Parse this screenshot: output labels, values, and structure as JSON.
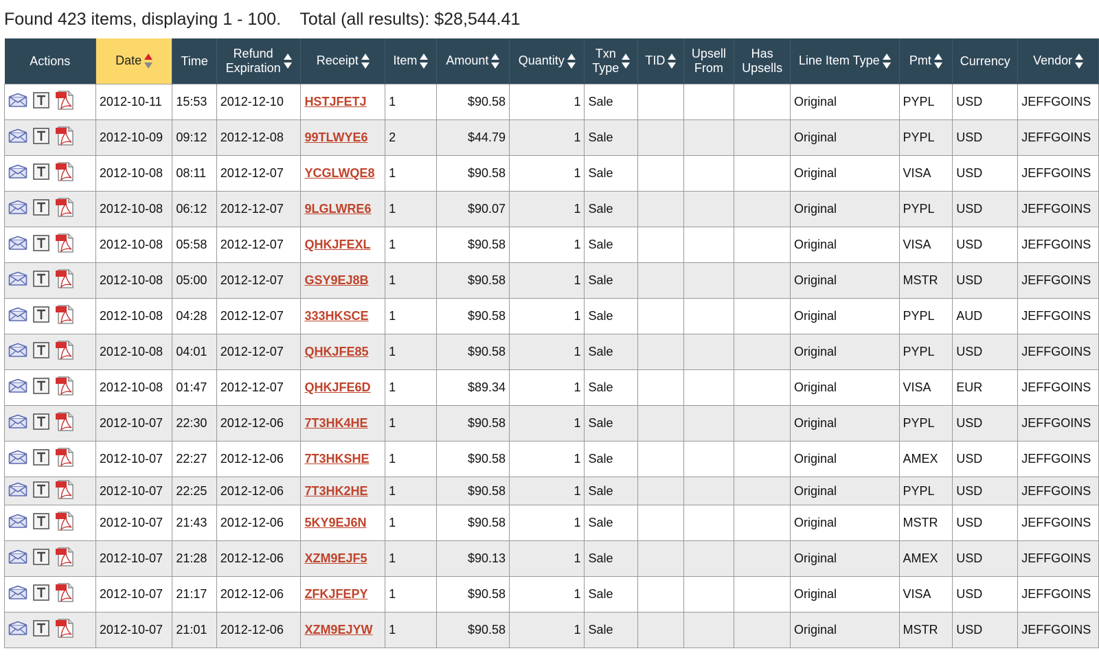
{
  "summary": "Found 423 items, displaying 1 - 100.    Total (all results): $28,544.41",
  "colors": {
    "header_bg": "#2f4858",
    "sorted_header_bg": "#fcd86a",
    "receipt_link": "#c0432b",
    "alt_row": "#ebebeb"
  },
  "columns": {
    "actions": "Actions",
    "date": "Date",
    "time": "Time",
    "refund_l1": "Refund",
    "refund_l2": "Expiration",
    "receipt": "Receipt",
    "item": "Item",
    "amount": "Amount",
    "quantity": "Quantity",
    "txn_l1": "Txn",
    "txn_l2": "Type",
    "tid": "TID",
    "upsell_l1": "Upsell",
    "upsell_l2": "From",
    "has_l1": "Has",
    "has_l2": "Upsells",
    "line_item_type": "Line Item Type",
    "pmt": "Pmt",
    "currency": "Currency",
    "vendor": "Vendor"
  },
  "action_icons": [
    "envelope-icon",
    "text-t-icon",
    "pdf-icon"
  ],
  "rows": [
    {
      "date": "2012-10-11",
      "time": "15:53",
      "refund": "2012-12-10",
      "receipt": "HSTJFETJ",
      "item": "1",
      "amount": "$90.58",
      "quantity": "1",
      "txn_type": "Sale",
      "tid": "",
      "upsell_from": "",
      "has_upsells": "",
      "line_item_type": "Original",
      "pmt": "PYPL",
      "currency": "USD",
      "vendor": "JEFFGOINS"
    },
    {
      "date": "2012-10-09",
      "time": "09:12",
      "refund": "2012-12-08",
      "receipt": "99TLWYE6",
      "item": "2",
      "amount": "$44.79",
      "quantity": "1",
      "txn_type": "Sale",
      "tid": "",
      "upsell_from": "",
      "has_upsells": "",
      "line_item_type": "Original",
      "pmt": "PYPL",
      "currency": "USD",
      "vendor": "JEFFGOINS"
    },
    {
      "date": "2012-10-08",
      "time": "08:11",
      "refund": "2012-12-07",
      "receipt": "YCGLWQE8",
      "item": "1",
      "amount": "$90.58",
      "quantity": "1",
      "txn_type": "Sale",
      "tid": "",
      "upsell_from": "",
      "has_upsells": "",
      "line_item_type": "Original",
      "pmt": "VISA",
      "currency": "USD",
      "vendor": "JEFFGOINS"
    },
    {
      "date": "2012-10-08",
      "time": "06:12",
      "refund": "2012-12-07",
      "receipt": "9LGLWRE6",
      "item": "1",
      "amount": "$90.07",
      "quantity": "1",
      "txn_type": "Sale",
      "tid": "",
      "upsell_from": "",
      "has_upsells": "",
      "line_item_type": "Original",
      "pmt": "PYPL",
      "currency": "USD",
      "vendor": "JEFFGOINS"
    },
    {
      "date": "2012-10-08",
      "time": "05:58",
      "refund": "2012-12-07",
      "receipt": "QHKJFEXL",
      "item": "1",
      "amount": "$90.58",
      "quantity": "1",
      "txn_type": "Sale",
      "tid": "",
      "upsell_from": "",
      "has_upsells": "",
      "line_item_type": "Original",
      "pmt": "VISA",
      "currency": "USD",
      "vendor": "JEFFGOINS"
    },
    {
      "date": "2012-10-08",
      "time": "05:00",
      "refund": "2012-12-07",
      "receipt": "GSY9EJ8B",
      "item": "1",
      "amount": "$90.58",
      "quantity": "1",
      "txn_type": "Sale",
      "tid": "",
      "upsell_from": "",
      "has_upsells": "",
      "line_item_type": "Original",
      "pmt": "MSTR",
      "currency": "USD",
      "vendor": "JEFFGOINS"
    },
    {
      "date": "2012-10-08",
      "time": "04:28",
      "refund": "2012-12-07",
      "receipt": "333HKSCE",
      "item": "1",
      "amount": "$90.58",
      "quantity": "1",
      "txn_type": "Sale",
      "tid": "",
      "upsell_from": "",
      "has_upsells": "",
      "line_item_type": "Original",
      "pmt": "PYPL",
      "currency": "AUD",
      "vendor": "JEFFGOINS"
    },
    {
      "date": "2012-10-08",
      "time": "04:01",
      "refund": "2012-12-07",
      "receipt": "QHKJFE85",
      "item": "1",
      "amount": "$90.58",
      "quantity": "1",
      "txn_type": "Sale",
      "tid": "",
      "upsell_from": "",
      "has_upsells": "",
      "line_item_type": "Original",
      "pmt": "PYPL",
      "currency": "USD",
      "vendor": "JEFFGOINS"
    },
    {
      "date": "2012-10-08",
      "time": "01:47",
      "refund": "2012-12-07",
      "receipt": "QHKJFE6D",
      "item": "1",
      "amount": "$89.34",
      "quantity": "1",
      "txn_type": "Sale",
      "tid": "",
      "upsell_from": "",
      "has_upsells": "",
      "line_item_type": "Original",
      "pmt": "VISA",
      "currency": "EUR",
      "vendor": "JEFFGOINS"
    },
    {
      "date": "2012-10-07",
      "time": "22:30",
      "refund": "2012-12-06",
      "receipt": "7T3HK4HE",
      "item": "1",
      "amount": "$90.58",
      "quantity": "1",
      "txn_type": "Sale",
      "tid": "",
      "upsell_from": "",
      "has_upsells": "",
      "line_item_type": "Original",
      "pmt": "PYPL",
      "currency": "USD",
      "vendor": "JEFFGOINS"
    },
    {
      "date": "2012-10-07",
      "time": "22:27",
      "refund": "2012-12-06",
      "receipt": "7T3HKSHE",
      "item": "1",
      "amount": "$90.58",
      "quantity": "1",
      "txn_type": "Sale",
      "tid": "",
      "upsell_from": "",
      "has_upsells": "",
      "line_item_type": "Original",
      "pmt": "AMEX",
      "currency": "USD",
      "vendor": "JEFFGOINS"
    },
    {
      "date": "2012-10-07",
      "time": "22:25",
      "refund": "2012-12-06",
      "receipt": "7T3HK2HE",
      "item": "1",
      "amount": "$90.58",
      "quantity": "1",
      "txn_type": "Sale",
      "tid": "",
      "upsell_from": "",
      "has_upsells": "",
      "line_item_type": "Original",
      "pmt": "PYPL",
      "currency": "USD",
      "vendor": "JEFFGOINS"
    },
    {
      "date": "2012-10-07",
      "time": "21:43",
      "refund": "2012-12-06",
      "receipt": "5KY9EJ6N",
      "item": "1",
      "amount": "$90.58",
      "quantity": "1",
      "txn_type": "Sale",
      "tid": "",
      "upsell_from": "",
      "has_upsells": "",
      "line_item_type": "Original",
      "pmt": "MSTR",
      "currency": "USD",
      "vendor": "JEFFGOINS"
    },
    {
      "date": "2012-10-07",
      "time": "21:28",
      "refund": "2012-12-06",
      "receipt": "XZM9EJF5",
      "item": "1",
      "amount": "$90.13",
      "quantity": "1",
      "txn_type": "Sale",
      "tid": "",
      "upsell_from": "",
      "has_upsells": "",
      "line_item_type": "Original",
      "pmt": "AMEX",
      "currency": "USD",
      "vendor": "JEFFGOINS"
    },
    {
      "date": "2012-10-07",
      "time": "21:17",
      "refund": "2012-12-06",
      "receipt": "ZFKJFEPY",
      "item": "1",
      "amount": "$90.58",
      "quantity": "1",
      "txn_type": "Sale",
      "tid": "",
      "upsell_from": "",
      "has_upsells": "",
      "line_item_type": "Original",
      "pmt": "VISA",
      "currency": "USD",
      "vendor": "JEFFGOINS"
    },
    {
      "date": "2012-10-07",
      "time": "21:01",
      "refund": "2012-12-06",
      "receipt": "XZM9EJYW",
      "item": "1",
      "amount": "$90.58",
      "quantity": "1",
      "txn_type": "Sale",
      "tid": "",
      "upsell_from": "",
      "has_upsells": "",
      "line_item_type": "Original",
      "pmt": "MSTR",
      "currency": "USD",
      "vendor": "JEFFGOINS"
    }
  ]
}
